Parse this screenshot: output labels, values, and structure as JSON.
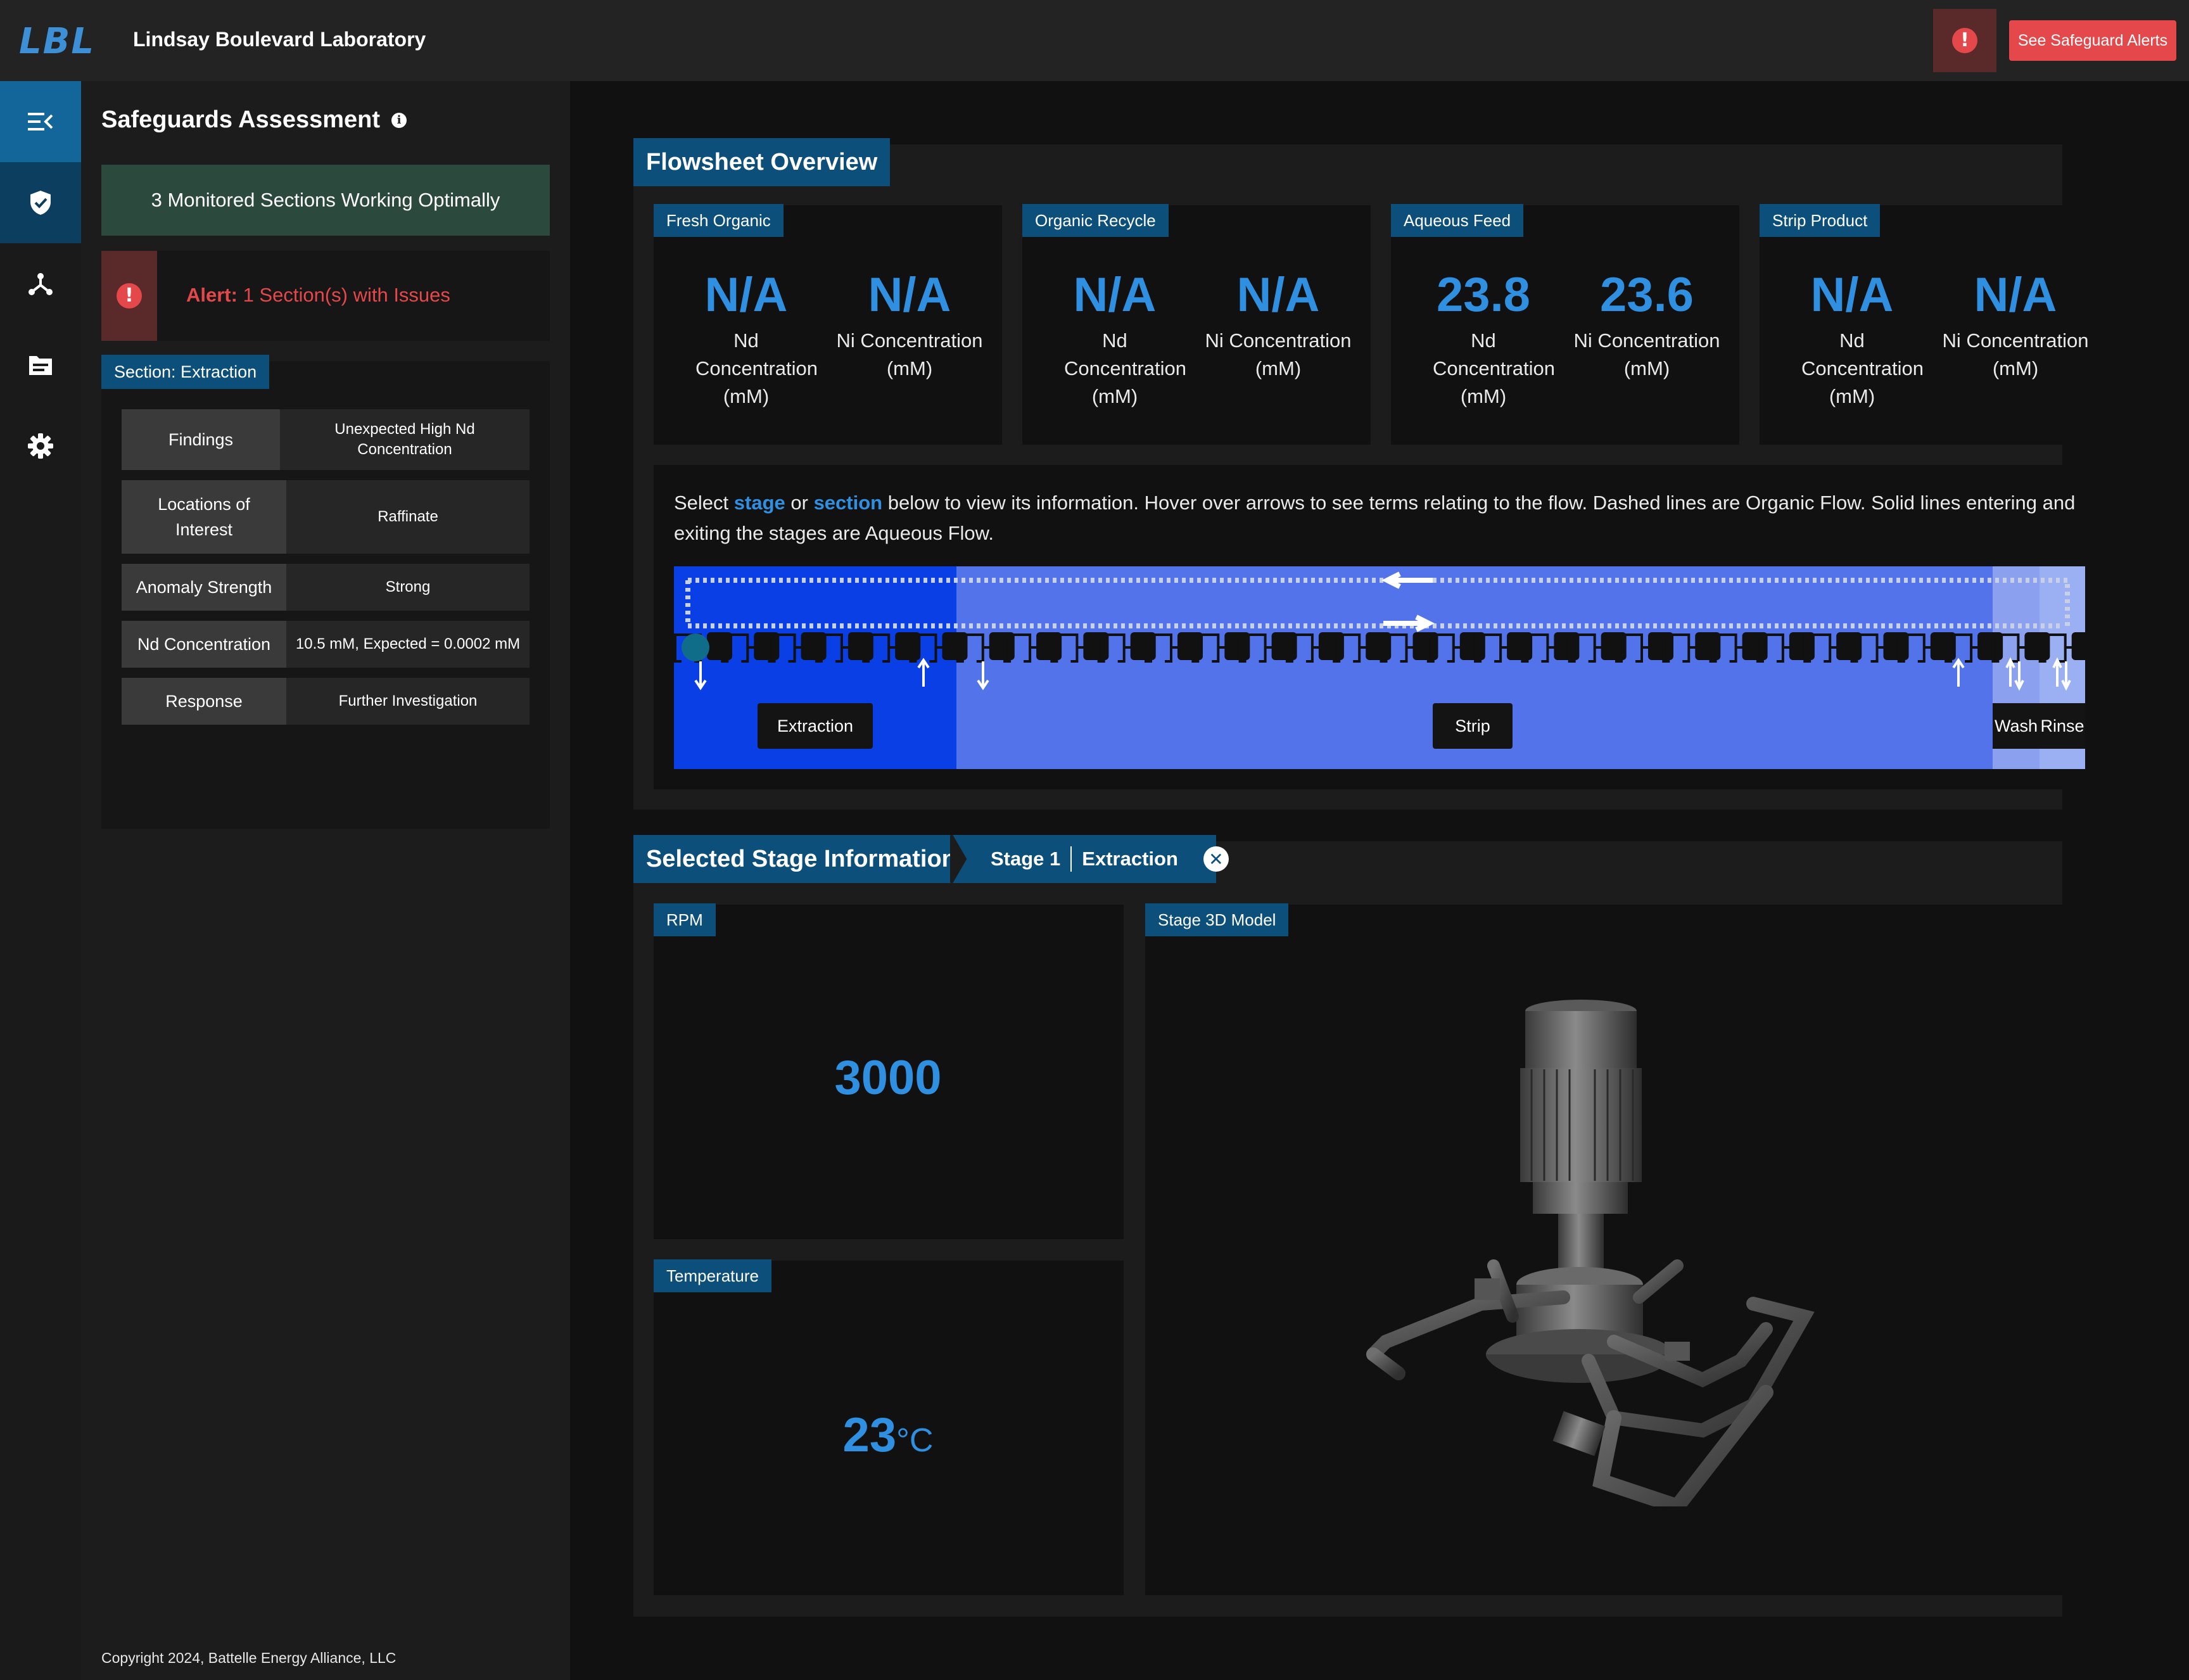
{
  "header": {
    "logo_text": "LBL",
    "lab_name": "Lindsay Boulevard Laboratory",
    "alert_button": "See Safeguard Alerts",
    "alert_icon": "exclamation-circle-icon",
    "accent_color": "#e4484a"
  },
  "rail": {
    "items": [
      {
        "name": "menu-collapse-icon"
      },
      {
        "name": "shield-check-icon"
      },
      {
        "name": "network-nodes-icon"
      },
      {
        "name": "document-icon"
      },
      {
        "name": "gear-icon"
      }
    ]
  },
  "sidebar": {
    "title": "Safeguards Assessment",
    "ok_status": "3 Monitored Sections Working Optimally",
    "alert_prefix": "Alert:",
    "alert_text": " 1 Section(s) with Issues",
    "section_tag": "Section: Extraction",
    "findings": [
      {
        "key": "Findings",
        "value": "Unexpected High Nd Concentration"
      },
      {
        "key": "Locations of Interest",
        "value": "Raffinate"
      },
      {
        "key": "Anomaly Strength",
        "value": "Strong"
      },
      {
        "key": "Nd Concentration",
        "value": "10.5 mM, Expected = 0.0002 mM"
      },
      {
        "key": "Response",
        "value": "Further Investigation"
      }
    ],
    "copyright": "Copyright 2024, Battelle Energy Alliance, LLC"
  },
  "flowsheet": {
    "title": "Flowsheet Overview",
    "cards": [
      {
        "tag": "Fresh Organic",
        "nd_value": "N/A",
        "nd_label": "Nd Concentration (mM)",
        "ni_value": "N/A",
        "ni_label": "Ni Concentration (mM)"
      },
      {
        "tag": "Organic Recycle",
        "nd_value": "N/A",
        "nd_label": "Nd Concentration (mM)",
        "ni_value": "N/A",
        "ni_label": "Ni Concentration (mM)"
      },
      {
        "tag": "Aqueous Feed",
        "nd_value": "23.8",
        "nd_label": "Nd Concentration (mM)",
        "ni_value": "23.6",
        "ni_label": "Ni Concentration (mM)"
      },
      {
        "tag": "Strip Product",
        "nd_value": "N/A",
        "nd_label": "Nd Concentration (mM)",
        "ni_value": "N/A",
        "ni_label": "Ni Concentration (mM)"
      }
    ],
    "instr_1": "Select ",
    "instr_stage": "stage",
    "instr_2": " or ",
    "instr_section": "section",
    "instr_3": " below to view its information. Hover over arrows to see terms relating to the flow. Dashed lines are Organic Flow. Solid lines entering and exiting the stages are Aqueous Flow.",
    "sections": [
      "Extraction",
      "Strip",
      "Wash",
      "Rinse"
    ],
    "colors": {
      "extraction": "#0a3fe6",
      "strip": "#5273ea",
      "wash": "#8ba0ee",
      "rinse": "#9bb0f2"
    }
  },
  "stage_info": {
    "title": "Selected Stage Information",
    "stage": "Stage 1",
    "section": "Extraction",
    "rpm_tag": "RPM",
    "rpm_value": "3000",
    "model_tag": "Stage 3D Model",
    "temp_tag": "Temperature",
    "temp_value": "23",
    "temp_unit": "°C"
  }
}
